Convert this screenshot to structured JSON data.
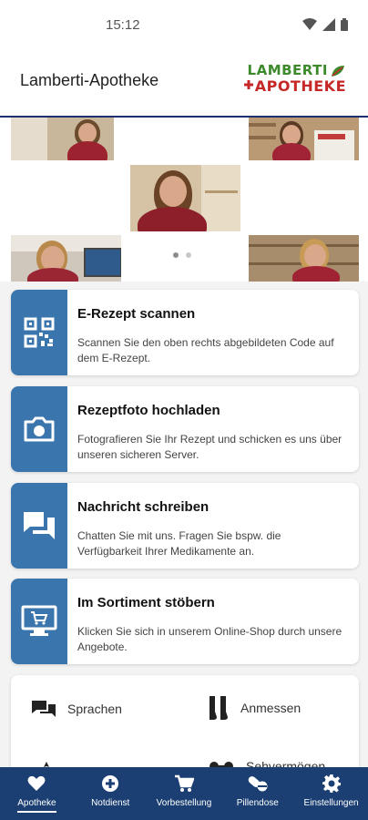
{
  "status_bar": {
    "time": "15:12",
    "icons": [
      "wifi-icon",
      "signal-icon",
      "battery-icon"
    ]
  },
  "app_bar": {
    "title": "Lamberti-Apotheke",
    "logo_line1": "LAMBERTI",
    "logo_line2": "APOTHEKE"
  },
  "carousel": {
    "page_count": 2,
    "active_index": 0
  },
  "actions": [
    {
      "icon": "qr-code-icon",
      "title": "E-Rezept scannen",
      "description": "Scannen Sie den oben rechts abgebildeten Code auf dem E-Rezept."
    },
    {
      "icon": "camera-icon",
      "title": "Rezeptfoto hochladen",
      "description": "Fotografieren Sie Ihr Rezept und schicken es uns über unseren sicheren Server."
    },
    {
      "icon": "chat-icon",
      "title": "Nachricht schreiben",
      "description": "Chatten Sie mit uns. Fragen Sie bspw. die Verfügbarkeit Ihrer Medikamente an."
    },
    {
      "icon": "shop-cart-icon",
      "title": "Im Sortiment stöbern",
      "description": "Klicken Sie sich in unserem Online-Shop durch unsere Angebote."
    }
  ],
  "quick_links": [
    {
      "icon": "speech-icon",
      "label": "Sprachen"
    },
    {
      "icon": "stockings-icon",
      "label": "Anmessen"
    },
    {
      "icon": "pin-icon",
      "label": ""
    },
    {
      "icon": "glasses-icon",
      "label": "Sehvermögen"
    }
  ],
  "bottom_nav": [
    {
      "icon": "heart-icon",
      "label": "Apotheke",
      "active": true
    },
    {
      "icon": "emergency-icon",
      "label": "Notdienst",
      "active": false
    },
    {
      "icon": "cart-icon",
      "label": "Vorbestellung",
      "active": false
    },
    {
      "icon": "pills-icon",
      "label": "Pillendose",
      "active": false
    },
    {
      "icon": "gear-icon",
      "label": "Einstellungen",
      "active": false
    }
  ],
  "colors": {
    "accent": "#3a76ad",
    "nav_background": "#1b3f73",
    "logo_green": "#3c8a2b",
    "logo_red": "#c62828"
  }
}
